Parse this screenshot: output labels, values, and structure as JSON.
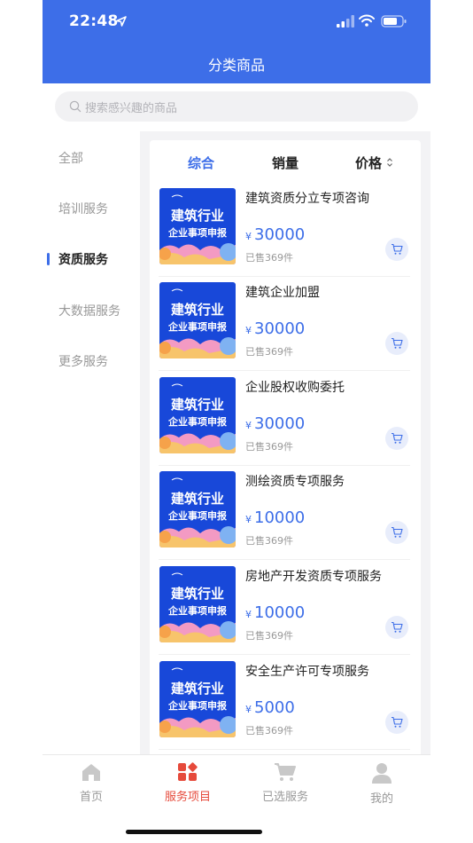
{
  "status_bar": {
    "time": "22:48"
  },
  "header": {
    "title": "分类商品"
  },
  "search": {
    "placeholder": "搜索感兴趣的商品"
  },
  "categories": [
    {
      "label": "全部",
      "active": false
    },
    {
      "label": "培训服务",
      "active": false
    },
    {
      "label": "资质服务",
      "active": true
    },
    {
      "label": "大数据服务",
      "active": false
    },
    {
      "label": "更多服务",
      "active": false
    }
  ],
  "sort": {
    "comprehensive": "综合",
    "sales": "销量",
    "price": "价格"
  },
  "thumbnail": {
    "line1": "建筑行业",
    "line2": "企业事项申报"
  },
  "currency": "¥",
  "products": [
    {
      "name": "建筑资质分立专项咨询",
      "price": "30000",
      "sold": "已售369件"
    },
    {
      "name": "建筑企业加盟",
      "price": "30000",
      "sold": "已售369件"
    },
    {
      "name": "企业股权收购委托",
      "price": "30000",
      "sold": "已售369件"
    },
    {
      "name": "测绘资质专项服务",
      "price": "10000",
      "sold": "已售369件"
    },
    {
      "name": "房地产开发资质专项服务",
      "price": "10000",
      "sold": "已售369件"
    },
    {
      "name": "安全生产许可专项服务",
      "price": "5000",
      "sold": "已售369件"
    }
  ],
  "tabbar": [
    {
      "label": "首页",
      "icon": "home-icon",
      "active": false
    },
    {
      "label": "服务项目",
      "icon": "grid-icon",
      "active": true
    },
    {
      "label": "已选服务",
      "icon": "cart-icon",
      "active": false
    },
    {
      "label": "我的",
      "icon": "user-icon",
      "active": false
    }
  ],
  "colors": {
    "primary": "#3d6ee8",
    "tab_active": "#e64a3b"
  }
}
